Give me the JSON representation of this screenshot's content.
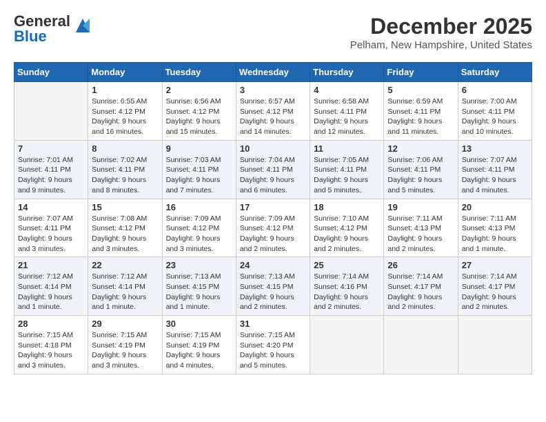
{
  "header": {
    "logo_general": "General",
    "logo_blue": "Blue",
    "month": "December 2025",
    "location": "Pelham, New Hampshire, United States"
  },
  "days_of_week": [
    "Sunday",
    "Monday",
    "Tuesday",
    "Wednesday",
    "Thursday",
    "Friday",
    "Saturday"
  ],
  "weeks": [
    [
      {
        "day": "",
        "empty": true
      },
      {
        "day": "1",
        "sunrise": "Sunrise: 6:55 AM",
        "sunset": "Sunset: 4:12 PM",
        "daylight": "Daylight: 9 hours and 16 minutes."
      },
      {
        "day": "2",
        "sunrise": "Sunrise: 6:56 AM",
        "sunset": "Sunset: 4:12 PM",
        "daylight": "Daylight: 9 hours and 15 minutes."
      },
      {
        "day": "3",
        "sunrise": "Sunrise: 6:57 AM",
        "sunset": "Sunset: 4:12 PM",
        "daylight": "Daylight: 9 hours and 14 minutes."
      },
      {
        "day": "4",
        "sunrise": "Sunrise: 6:58 AM",
        "sunset": "Sunset: 4:11 PM",
        "daylight": "Daylight: 9 hours and 12 minutes."
      },
      {
        "day": "5",
        "sunrise": "Sunrise: 6:59 AM",
        "sunset": "Sunset: 4:11 PM",
        "daylight": "Daylight: 9 hours and 11 minutes."
      },
      {
        "day": "6",
        "sunrise": "Sunrise: 7:00 AM",
        "sunset": "Sunset: 4:11 PM",
        "daylight": "Daylight: 9 hours and 10 minutes."
      }
    ],
    [
      {
        "day": "7",
        "sunrise": "Sunrise: 7:01 AM",
        "sunset": "Sunset: 4:11 PM",
        "daylight": "Daylight: 9 hours and 9 minutes."
      },
      {
        "day": "8",
        "sunrise": "Sunrise: 7:02 AM",
        "sunset": "Sunset: 4:11 PM",
        "daylight": "Daylight: 9 hours and 8 minutes."
      },
      {
        "day": "9",
        "sunrise": "Sunrise: 7:03 AM",
        "sunset": "Sunset: 4:11 PM",
        "daylight": "Daylight: 9 hours and 7 minutes."
      },
      {
        "day": "10",
        "sunrise": "Sunrise: 7:04 AM",
        "sunset": "Sunset: 4:11 PM",
        "daylight": "Daylight: 9 hours and 6 minutes."
      },
      {
        "day": "11",
        "sunrise": "Sunrise: 7:05 AM",
        "sunset": "Sunset: 4:11 PM",
        "daylight": "Daylight: 9 hours and 5 minutes."
      },
      {
        "day": "12",
        "sunrise": "Sunrise: 7:06 AM",
        "sunset": "Sunset: 4:11 PM",
        "daylight": "Daylight: 9 hours and 5 minutes."
      },
      {
        "day": "13",
        "sunrise": "Sunrise: 7:07 AM",
        "sunset": "Sunset: 4:11 PM",
        "daylight": "Daylight: 9 hours and 4 minutes."
      }
    ],
    [
      {
        "day": "14",
        "sunrise": "Sunrise: 7:07 AM",
        "sunset": "Sunset: 4:11 PM",
        "daylight": "Daylight: 9 hours and 3 minutes."
      },
      {
        "day": "15",
        "sunrise": "Sunrise: 7:08 AM",
        "sunset": "Sunset: 4:12 PM",
        "daylight": "Daylight: 9 hours and 3 minutes."
      },
      {
        "day": "16",
        "sunrise": "Sunrise: 7:09 AM",
        "sunset": "Sunset: 4:12 PM",
        "daylight": "Daylight: 9 hours and 3 minutes."
      },
      {
        "day": "17",
        "sunrise": "Sunrise: 7:09 AM",
        "sunset": "Sunset: 4:12 PM",
        "daylight": "Daylight: 9 hours and 2 minutes."
      },
      {
        "day": "18",
        "sunrise": "Sunrise: 7:10 AM",
        "sunset": "Sunset: 4:12 PM",
        "daylight": "Daylight: 9 hours and 2 minutes."
      },
      {
        "day": "19",
        "sunrise": "Sunrise: 7:11 AM",
        "sunset": "Sunset: 4:13 PM",
        "daylight": "Daylight: 9 hours and 2 minutes."
      },
      {
        "day": "20",
        "sunrise": "Sunrise: 7:11 AM",
        "sunset": "Sunset: 4:13 PM",
        "daylight": "Daylight: 9 hours and 1 minute."
      }
    ],
    [
      {
        "day": "21",
        "sunrise": "Sunrise: 7:12 AM",
        "sunset": "Sunset: 4:14 PM",
        "daylight": "Daylight: 9 hours and 1 minute."
      },
      {
        "day": "22",
        "sunrise": "Sunrise: 7:12 AM",
        "sunset": "Sunset: 4:14 PM",
        "daylight": "Daylight: 9 hours and 1 minute."
      },
      {
        "day": "23",
        "sunrise": "Sunrise: 7:13 AM",
        "sunset": "Sunset: 4:15 PM",
        "daylight": "Daylight: 9 hours and 1 minute."
      },
      {
        "day": "24",
        "sunrise": "Sunrise: 7:13 AM",
        "sunset": "Sunset: 4:15 PM",
        "daylight": "Daylight: 9 hours and 2 minutes."
      },
      {
        "day": "25",
        "sunrise": "Sunrise: 7:14 AM",
        "sunset": "Sunset: 4:16 PM",
        "daylight": "Daylight: 9 hours and 2 minutes."
      },
      {
        "day": "26",
        "sunrise": "Sunrise: 7:14 AM",
        "sunset": "Sunset: 4:17 PM",
        "daylight": "Daylight: 9 hours and 2 minutes."
      },
      {
        "day": "27",
        "sunrise": "Sunrise: 7:14 AM",
        "sunset": "Sunset: 4:17 PM",
        "daylight": "Daylight: 9 hours and 2 minutes."
      }
    ],
    [
      {
        "day": "28",
        "sunrise": "Sunrise: 7:15 AM",
        "sunset": "Sunset: 4:18 PM",
        "daylight": "Daylight: 9 hours and 3 minutes."
      },
      {
        "day": "29",
        "sunrise": "Sunrise: 7:15 AM",
        "sunset": "Sunset: 4:19 PM",
        "daylight": "Daylight: 9 hours and 3 minutes."
      },
      {
        "day": "30",
        "sunrise": "Sunrise: 7:15 AM",
        "sunset": "Sunset: 4:19 PM",
        "daylight": "Daylight: 9 hours and 4 minutes."
      },
      {
        "day": "31",
        "sunrise": "Sunrise: 7:15 AM",
        "sunset": "Sunset: 4:20 PM",
        "daylight": "Daylight: 9 hours and 5 minutes."
      },
      {
        "day": "",
        "empty": true
      },
      {
        "day": "",
        "empty": true
      },
      {
        "day": "",
        "empty": true
      }
    ]
  ]
}
